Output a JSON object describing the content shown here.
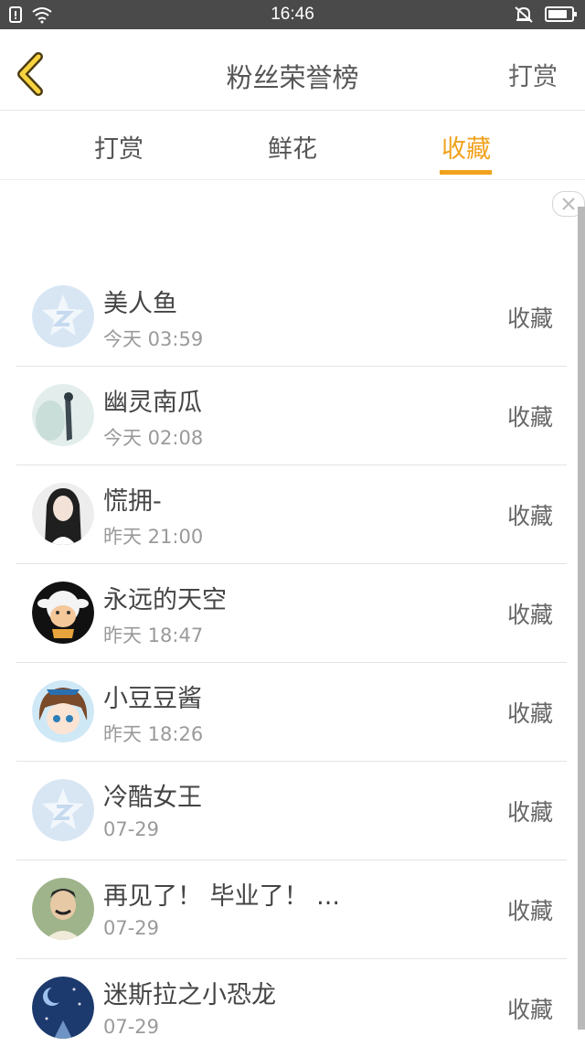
{
  "status_bar": {
    "time": "16:46"
  },
  "header": {
    "title": "粉丝荣誉榜",
    "right_action": "打赏"
  },
  "tabs": [
    {
      "label": "打赏",
      "active": false
    },
    {
      "label": "鲜花",
      "active": false
    },
    {
      "label": "收藏",
      "active": true
    }
  ],
  "colors": {
    "accent": "#f0a21e",
    "status_bar_bg": "#4a4a4a"
  },
  "list": [
    {
      "name": "美人鱼",
      "time": "今天 03:59",
      "action": "收藏",
      "avatar": "default-qzone-avatar"
    },
    {
      "name": "幽灵南瓜",
      "time": "今天 02:08",
      "action": "收藏",
      "avatar": "photo-avatar"
    },
    {
      "name": "慌拥-",
      "time": "昨天 21:00",
      "action": "收藏",
      "avatar": "photo-avatar"
    },
    {
      "name": "永远的天空",
      "time": "昨天 18:47",
      "action": "收藏",
      "avatar": "cartoon-avatar"
    },
    {
      "name": "小豆豆酱",
      "time": "昨天 18:26",
      "action": "收藏",
      "avatar": "anime-avatar"
    },
    {
      "name": "冷酷女王",
      "time": "07-29",
      "action": "收藏",
      "avatar": "default-qzone-avatar"
    },
    {
      "name": "再见了！ 毕业了！ ...",
      "time": "07-29",
      "action": "收藏",
      "avatar": "photo-avatar"
    },
    {
      "name": "迷斯拉之小恐龙",
      "time": "07-29",
      "action": "收藏",
      "avatar": "night-sky-avatar"
    }
  ]
}
